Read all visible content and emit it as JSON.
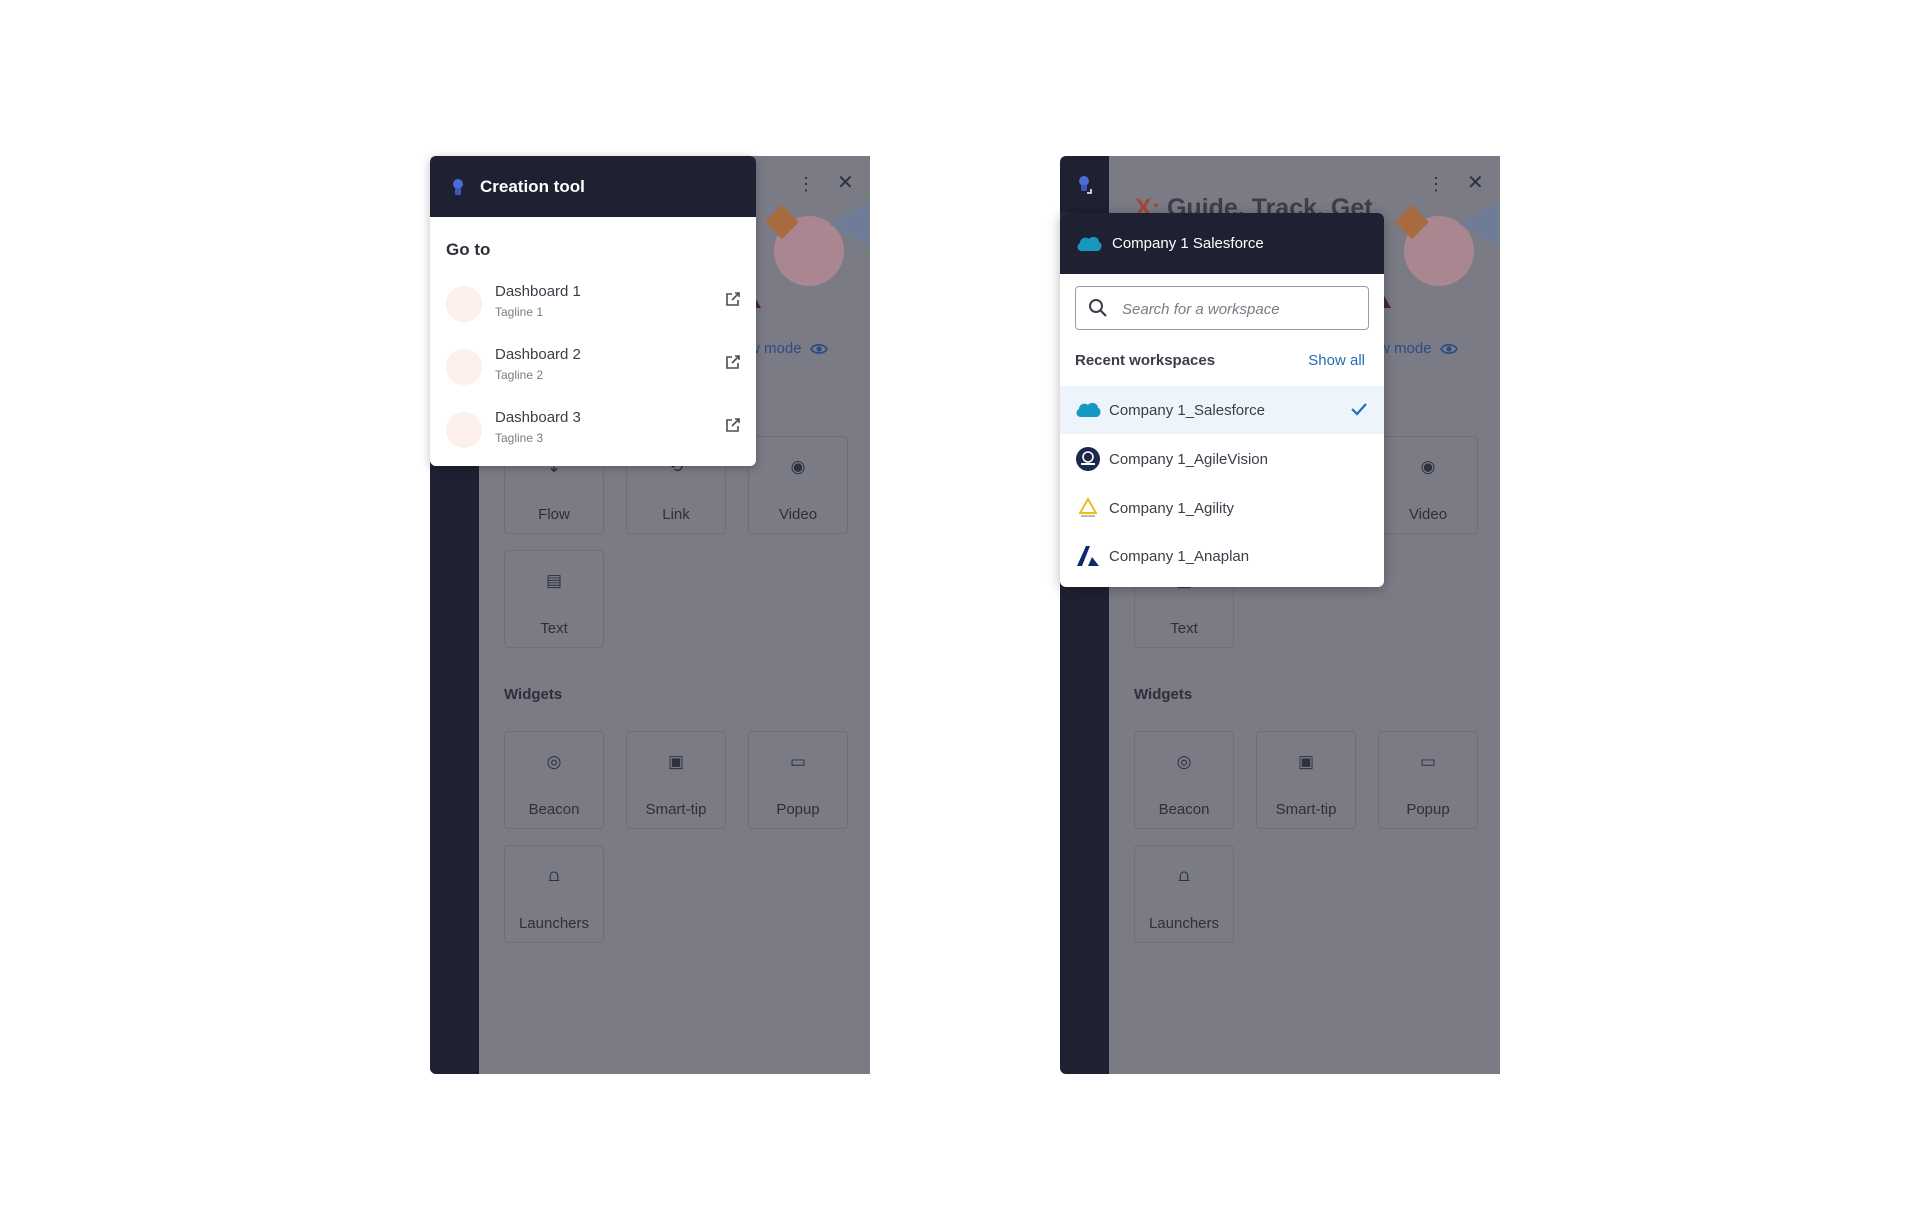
{
  "left_panel": {
    "popover": {
      "title": "Creation tool",
      "goto_label": "Go to",
      "dashboards": [
        {
          "name": "Dashboard 1",
          "tagline": "Tagline 1"
        },
        {
          "name": "Dashboard 2",
          "tagline": "Tagline 2"
        },
        {
          "name": "Dashboard 3",
          "tagline": "Tagline 3"
        }
      ]
    },
    "hero_title_fragment": "et",
    "preview_link": "w mode",
    "content_tiles": [
      {
        "label": "Flow",
        "icon": "flow-icon"
      },
      {
        "label": "Link",
        "icon": "link-icon"
      },
      {
        "label": "Video",
        "icon": "play-circle-icon"
      },
      {
        "label": "Text",
        "icon": "text-doc-icon"
      }
    ],
    "widgets_title": "Widgets",
    "widget_tiles": [
      {
        "label": "Beacon",
        "icon": "beacon-icon"
      },
      {
        "label": "Smart-tip",
        "icon": "smart-tip-icon"
      },
      {
        "label": "Popup",
        "icon": "popup-icon"
      },
      {
        "label": "Launchers",
        "icon": "launcher-icon"
      }
    ]
  },
  "right_panel": {
    "hero_title_prefix": "X:",
    "hero_title_rest": " Guide, Track, Get",
    "preview_link": "w mode",
    "visible_tiles": [
      {
        "label": "Video",
        "icon": "play-circle-icon"
      },
      {
        "label": "Text",
        "icon": "text-doc-icon"
      }
    ],
    "widgets_title": "Widgets",
    "widget_tiles": [
      {
        "label": "Beacon",
        "icon": "beacon-icon"
      },
      {
        "label": "Smart-tip",
        "icon": "smart-tip-icon"
      },
      {
        "label": "Popup",
        "icon": "popup-icon"
      },
      {
        "label": "Launchers",
        "icon": "launcher-icon"
      }
    ],
    "workspace_popover": {
      "title": "Company 1 Salesforce",
      "search_placeholder": "Search for a workspace",
      "search_value": "",
      "recent_label": "Recent workspaces",
      "show_all": "Show all",
      "workspaces": [
        {
          "name": "Company 1_Salesforce",
          "logo": "salesforce-logo",
          "selected": true
        },
        {
          "name": "Company 1_AgileVision",
          "logo": "agilevision-logo",
          "selected": false
        },
        {
          "name": "Company 1_Agility",
          "logo": "agility-logo",
          "selected": false
        },
        {
          "name": "Company 1_Anaplan",
          "logo": "anaplan-logo",
          "selected": false
        }
      ]
    }
  },
  "colors": {
    "header_dark": "#1f2032",
    "overlay_gray": "#7b7b86",
    "link_blue": "#1f6fb4",
    "selected_bg": "#edf4fc",
    "avatar_bg": "#fcefec"
  }
}
